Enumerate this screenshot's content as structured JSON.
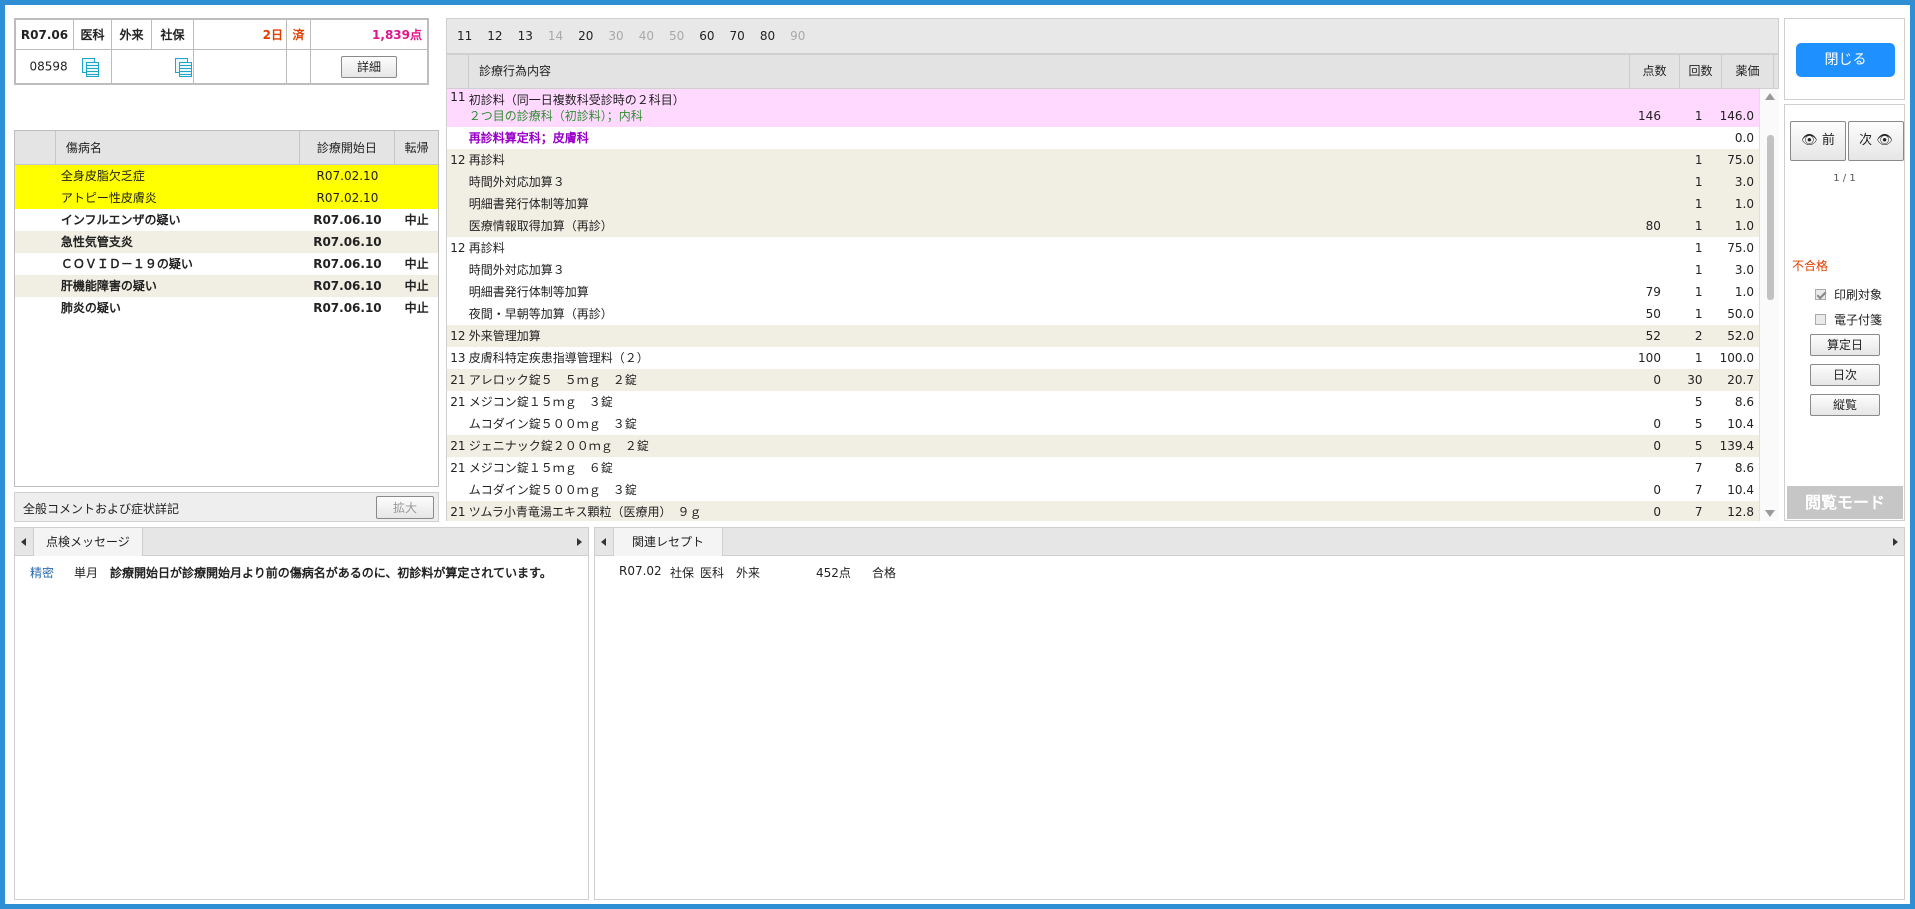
{
  "header": {
    "month": "R07.06",
    "type1": "医科",
    "type2": "外来",
    "insurance": "社保",
    "days": "2日",
    "done": "済",
    "points": "1,839点",
    "patient_no": "08598",
    "detail_button": "詳細"
  },
  "disease": {
    "columns": [
      "傷病名",
      "診療開始日",
      "転帰"
    ],
    "rows": [
      {
        "name": "全身皮脂欠乏症",
        "date": "R07.02.10",
        "outcome": "",
        "style": "yellow"
      },
      {
        "name": "アトピー性皮膚炎",
        "date": "R07.02.10",
        "outcome": "",
        "style": "yellow"
      },
      {
        "name": "インフルエンザの疑い",
        "date": "R07.06.10",
        "outcome": "中止",
        "style": "bold"
      },
      {
        "name": "急性気管支炎",
        "date": "R07.06.10",
        "outcome": "",
        "style": "bold-alt"
      },
      {
        "name": "ＣＯＶＩＤ－１９の疑い",
        "date": "R07.06.10",
        "outcome": "中止",
        "style": "bold"
      },
      {
        "name": "肝機能障害の疑い",
        "date": "R07.06.10",
        "outcome": "中止",
        "style": "bold-alt"
      },
      {
        "name": "肺炎の疑い",
        "date": "R07.06.10",
        "outcome": "中止",
        "style": "bold"
      }
    ]
  },
  "comment": {
    "label": "全般コメントおよび症状詳記",
    "expand_button": "拡大"
  },
  "tabs": [
    {
      "label": "11",
      "enabled": true
    },
    {
      "label": "12",
      "enabled": true
    },
    {
      "label": "13",
      "enabled": true
    },
    {
      "label": "14",
      "enabled": false
    },
    {
      "label": "20",
      "enabled": true
    },
    {
      "label": "30",
      "enabled": false
    },
    {
      "label": "40",
      "enabled": false
    },
    {
      "label": "50",
      "enabled": false
    },
    {
      "label": "60",
      "enabled": true
    },
    {
      "label": "70",
      "enabled": true
    },
    {
      "label": "80",
      "enabled": true
    },
    {
      "label": "90",
      "enabled": false
    }
  ],
  "table": {
    "columns": {
      "content": "診療行為内容",
      "points": "点数",
      "count": "回数",
      "price": "薬価"
    },
    "rows": [
      {
        "code": "11",
        "content": "初診料（同一日複数科受診時の２科目）",
        "content2": "２つ目の診療科（初診料）；内科",
        "points": "146",
        "count": "1",
        "price": "146.0",
        "style": "pink"
      },
      {
        "code": "",
        "content": "再診料算定科；皮膚科",
        "points": "",
        "count": "",
        "price": "0.0",
        "style": "purple"
      },
      {
        "code": "12",
        "content": "再診料",
        "points": "",
        "count": "1",
        "price": "75.0",
        "style": "alt"
      },
      {
        "code": "",
        "content": "時間外対応加算３",
        "points": "",
        "count": "1",
        "price": "3.0",
        "style": "alt"
      },
      {
        "code": "",
        "content": "明細書発行体制等加算",
        "points": "",
        "count": "1",
        "price": "1.0",
        "style": "alt"
      },
      {
        "code": "",
        "content": "医療情報取得加算（再診）",
        "points": "80",
        "count": "1",
        "price": "1.0",
        "style": "alt"
      },
      {
        "code": "12",
        "content": "再診料",
        "points": "",
        "count": "1",
        "price": "75.0",
        "style": ""
      },
      {
        "code": "",
        "content": "時間外対応加算３",
        "points": "",
        "count": "1",
        "price": "3.0",
        "style": ""
      },
      {
        "code": "",
        "content": "明細書発行体制等加算",
        "points": "79",
        "count": "1",
        "price": "1.0",
        "style": ""
      },
      {
        "code": "",
        "content": "夜間・早朝等加算（再診）",
        "points": "50",
        "count": "1",
        "price": "50.0",
        "style": ""
      },
      {
        "code": "12",
        "content": "外来管理加算",
        "points": "52",
        "count": "2",
        "price": "52.0",
        "style": "alt"
      },
      {
        "code": "13",
        "content": "皮膚科特定疾患指導管理料（２）",
        "points": "100",
        "count": "1",
        "price": "100.0",
        "style": ""
      },
      {
        "code": "21",
        "content": "アレロック錠５　５ｍｇ　２錠",
        "points": "0",
        "count": "30",
        "price": "20.7",
        "style": "alt"
      },
      {
        "code": "21",
        "content": "メジコン錠１５ｍｇ　３錠",
        "points": "",
        "count": "5",
        "price": "8.6",
        "style": ""
      },
      {
        "code": "",
        "content": "ムコダイン錠５００ｍｇ　３錠",
        "points": "0",
        "count": "5",
        "price": "10.4",
        "style": ""
      },
      {
        "code": "21",
        "content": "ジェニナック錠２００ｍｇ　２錠",
        "points": "0",
        "count": "5",
        "price": "139.4",
        "style": "alt"
      },
      {
        "code": "21",
        "content": "メジコン錠１５ｍｇ　６錠",
        "points": "",
        "count": "7",
        "price": "8.6",
        "style": ""
      },
      {
        "code": "",
        "content": "ムコダイン錠５００ｍｇ　３錠",
        "points": "0",
        "count": "7",
        "price": "10.4",
        "style": ""
      },
      {
        "code": "21",
        "content": "ツムラ小青竜湯エキス顆粒（医療用）　９ｇ",
        "points": "0",
        "count": "7",
        "price": "12.8",
        "style": "alt"
      }
    ]
  },
  "right_panel": {
    "close_button": "閉じる",
    "prev_button": "前",
    "next_button": "次",
    "page": "1 / 1",
    "status": "不合格",
    "print_target": "印刷対象",
    "electronic": "電子付箋",
    "calc_day_button": "算定日",
    "daily_button": "日次",
    "overview_button": "縦覧",
    "mode": "閲覧モード"
  },
  "check_pane": {
    "tab": "点検メッセージ",
    "level": "精密",
    "scope": "単月",
    "message": "診療開始日が診療開始月より前の傷病名があるのに、初診料が算定されています。"
  },
  "related_pane": {
    "tab": "関連レセプト",
    "entry": {
      "month": "R07.02",
      "insurance": "社保",
      "type1": "医科",
      "type2": "外来",
      "points": "452点",
      "result": "合格"
    }
  },
  "colors": {
    "frame": "#2f8fd4",
    "close_button": "#1e90ff",
    "highlight_yellow": "#ffff00",
    "highlight_pink": "#ffd9ff",
    "status_red": "#e03d00"
  }
}
